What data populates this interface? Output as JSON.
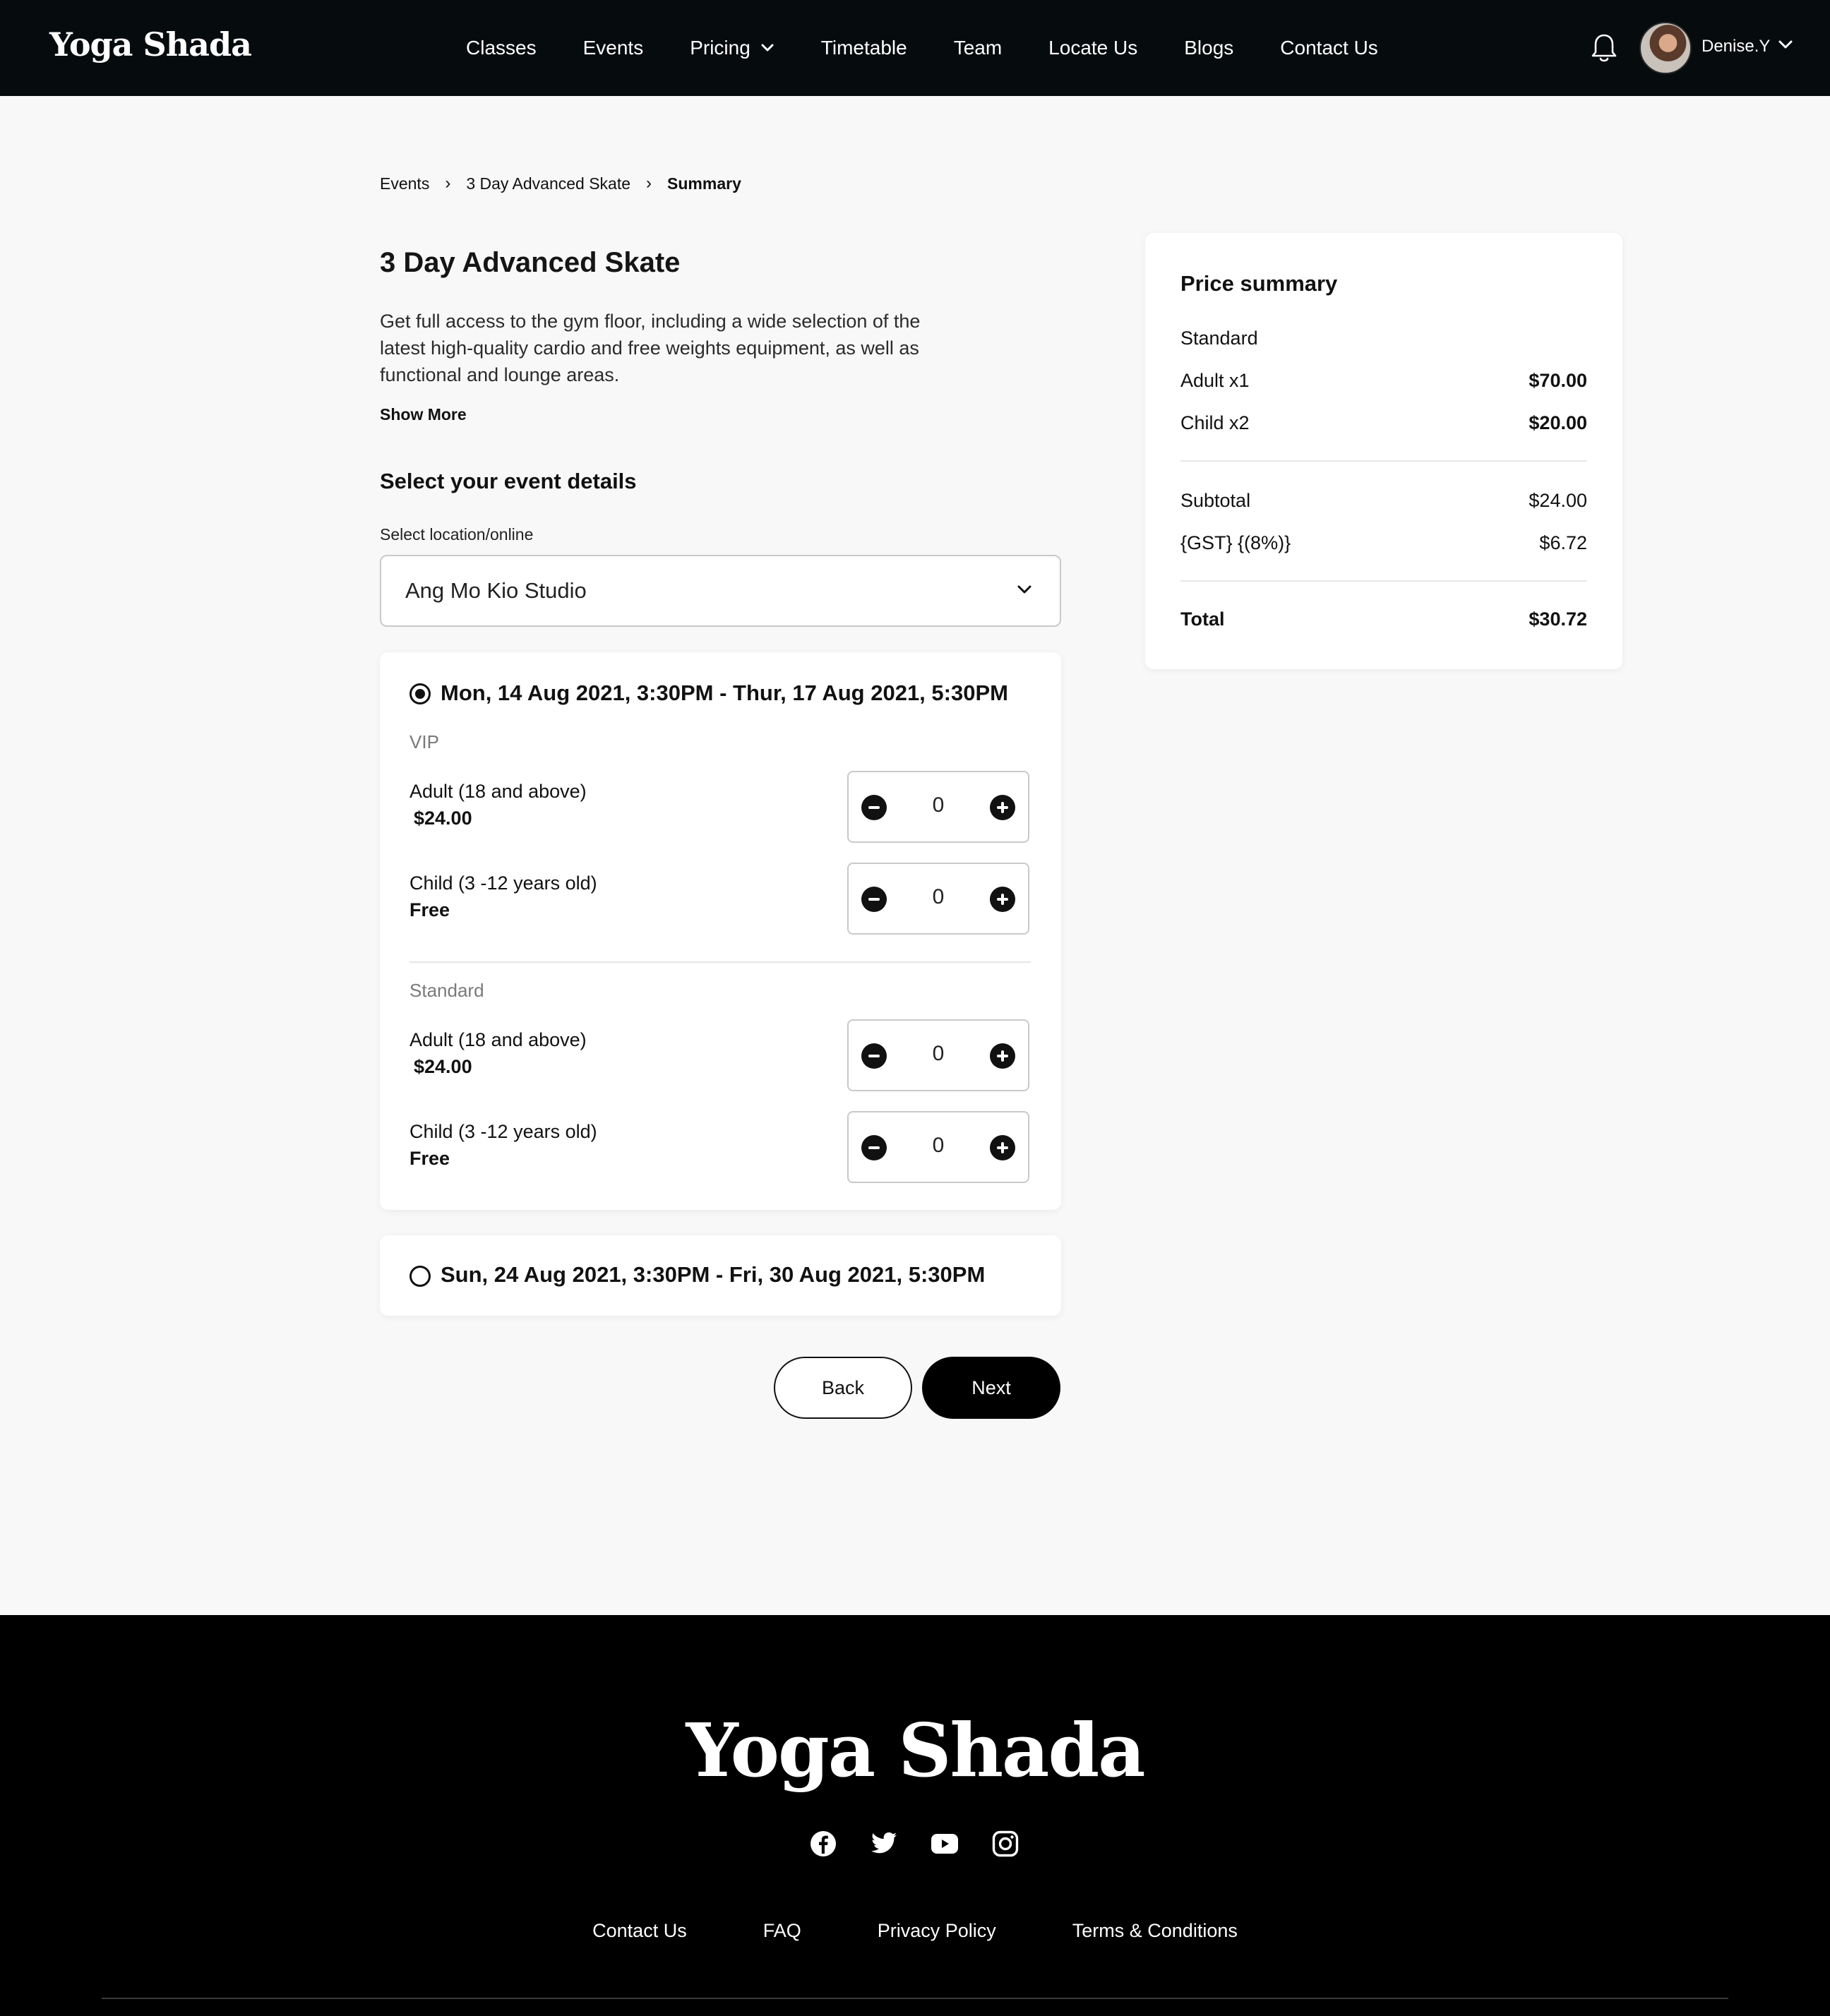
{
  "brand": {
    "name": "Yoga Shada"
  },
  "nav": {
    "items": [
      {
        "label": "Classes"
      },
      {
        "label": "Events"
      },
      {
        "label": "Pricing",
        "has_dropdown": true
      },
      {
        "label": "Timetable"
      },
      {
        "label": "Team"
      },
      {
        "label": "Locate Us"
      },
      {
        "label": "Blogs"
      },
      {
        "label": "Contact Us"
      }
    ]
  },
  "user": {
    "name": "Denise.Y"
  },
  "breadcrumb": {
    "items": [
      "Events",
      "3 Day Advanced Skate",
      "Summary"
    ]
  },
  "event": {
    "title": "3 Day Advanced Skate",
    "description": "Get full access to the gym floor, including a wide selection of the latest high-quality cardio and free weights equipment, as well as functional and lounge areas.",
    "show_more": "Show More"
  },
  "details": {
    "title": "Select your event details",
    "location_label": "Select location/online",
    "location_value": "Ang Mo Kio Studio"
  },
  "sessions": [
    {
      "label": "Mon, 14 Aug 2021, 3:30PM - Thur, 17 Aug 2021, 5:30PM",
      "selected": true,
      "tiers": [
        {
          "name": "VIP",
          "tickets": [
            {
              "name": "Adult (18 and above)",
              "price": "$24.00",
              "qty": "0"
            },
            {
              "name": "Child (3 -12 years old)",
              "price": "Free",
              "qty": "0"
            }
          ]
        },
        {
          "name": "Standard",
          "tickets": [
            {
              "name": "Adult (18 and above)",
              "price": "$24.00",
              "qty": "0"
            },
            {
              "name": "Child (3 -12 years old)",
              "price": "Free",
              "qty": "0"
            }
          ]
        }
      ]
    },
    {
      "label": "Sun, 24 Aug 2021, 3:30PM -  Fri, 30 Aug 2021, 5:30PM",
      "selected": false
    }
  ],
  "actions": {
    "back": "Back",
    "next": "Next"
  },
  "summary": {
    "title": "Price summary",
    "tier": "Standard",
    "lines": [
      {
        "label": "Adult x1",
        "value": "$70.00"
      },
      {
        "label": "Child x2",
        "value": "$20.00"
      }
    ],
    "subtotal_label": "Subtotal",
    "subtotal_value": "$24.00",
    "tax_label": "{GST} {(8%)}",
    "tax_value": "$6.72",
    "total_label": "Total",
    "total_value": "$30.72"
  },
  "footer": {
    "logo": "Yoga Shada",
    "socials": [
      "facebook-icon",
      "twitter-icon",
      "youtube-icon",
      "instagram-icon"
    ],
    "links": [
      "Contact Us",
      "FAQ",
      "Privacy Policy",
      "Terms & Conditions"
    ]
  },
  "colors": {
    "header_bg": "#060b0d",
    "footer_bg": "#000000",
    "page_bg": "#f8f8f8",
    "accent": "#000000"
  }
}
